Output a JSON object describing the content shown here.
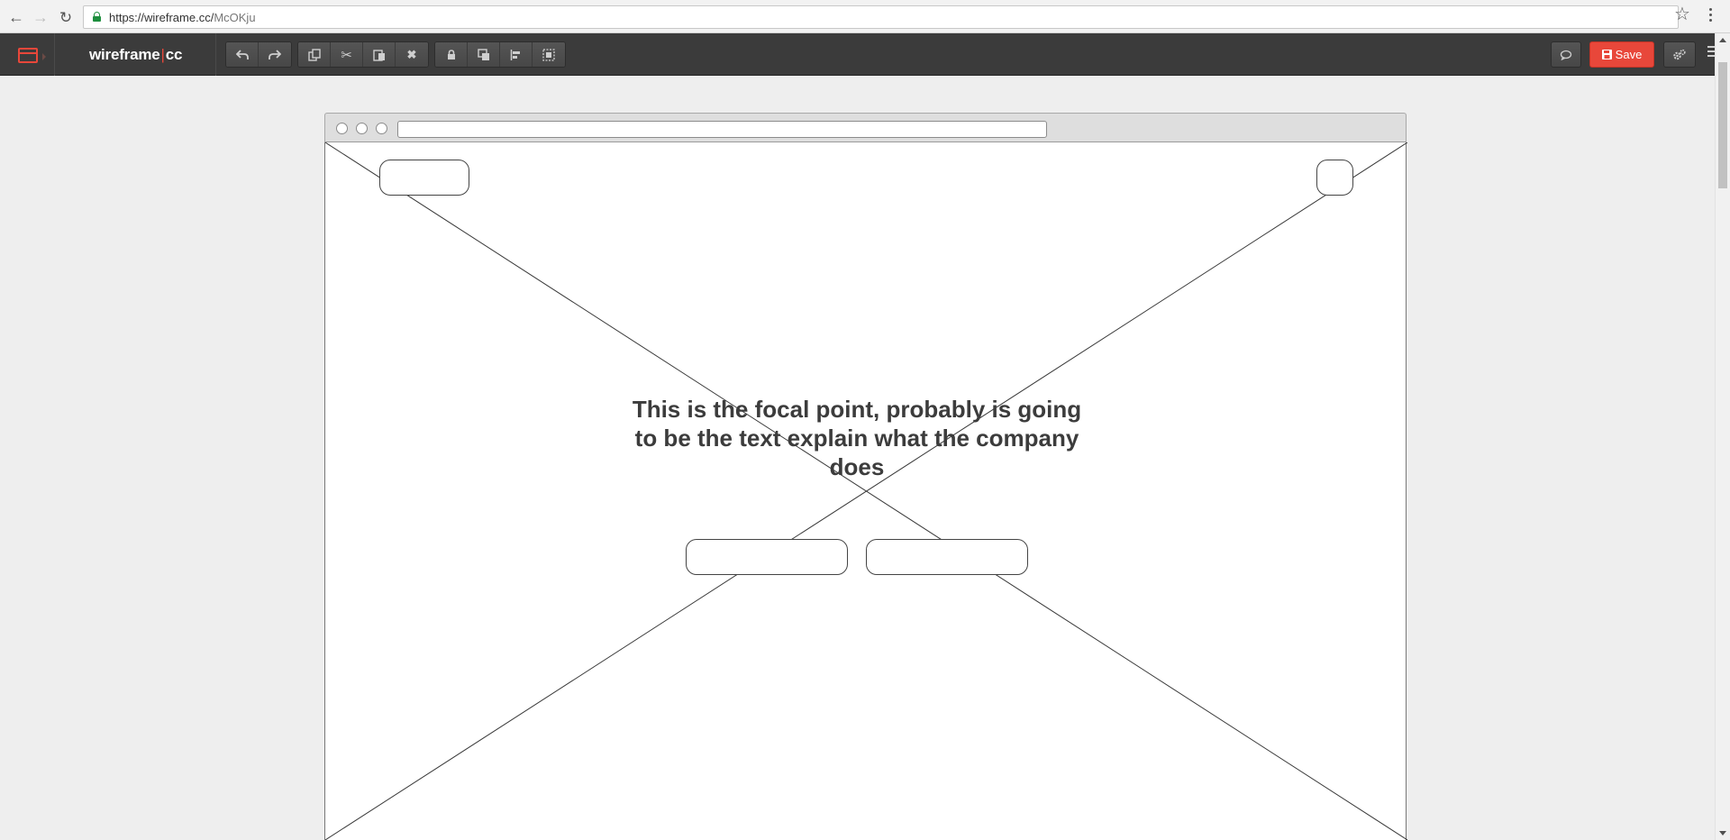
{
  "browser": {
    "url_host": "https://wireframe.cc/",
    "url_path": "McOKju",
    "icons": {
      "back": "arrow-left-icon",
      "forward": "arrow-right-icon",
      "reload": "reload-icon",
      "secure": "lock-icon",
      "bookmark": "star-icon",
      "menu": "kebab-menu-icon"
    }
  },
  "app": {
    "brand_left": "wireframe",
    "brand_sep": "|",
    "brand_right": "cc",
    "save_label": "Save",
    "accent_color": "#e8473a",
    "toolbar_groups": [
      [
        "undo-icon",
        "redo-icon"
      ],
      [
        "duplicate-icon",
        "cut-icon",
        "paste-icon",
        "delete-icon"
      ],
      [
        "lock-icon",
        "bring-to-front-icon",
        "align-icon",
        "group-icon"
      ]
    ],
    "right_icons": [
      "comment-icon",
      "settings-icon",
      "menu-icon"
    ]
  },
  "canvas": {
    "focal_text": "This is the focal point, probably is going to be the text explain what the company does"
  }
}
